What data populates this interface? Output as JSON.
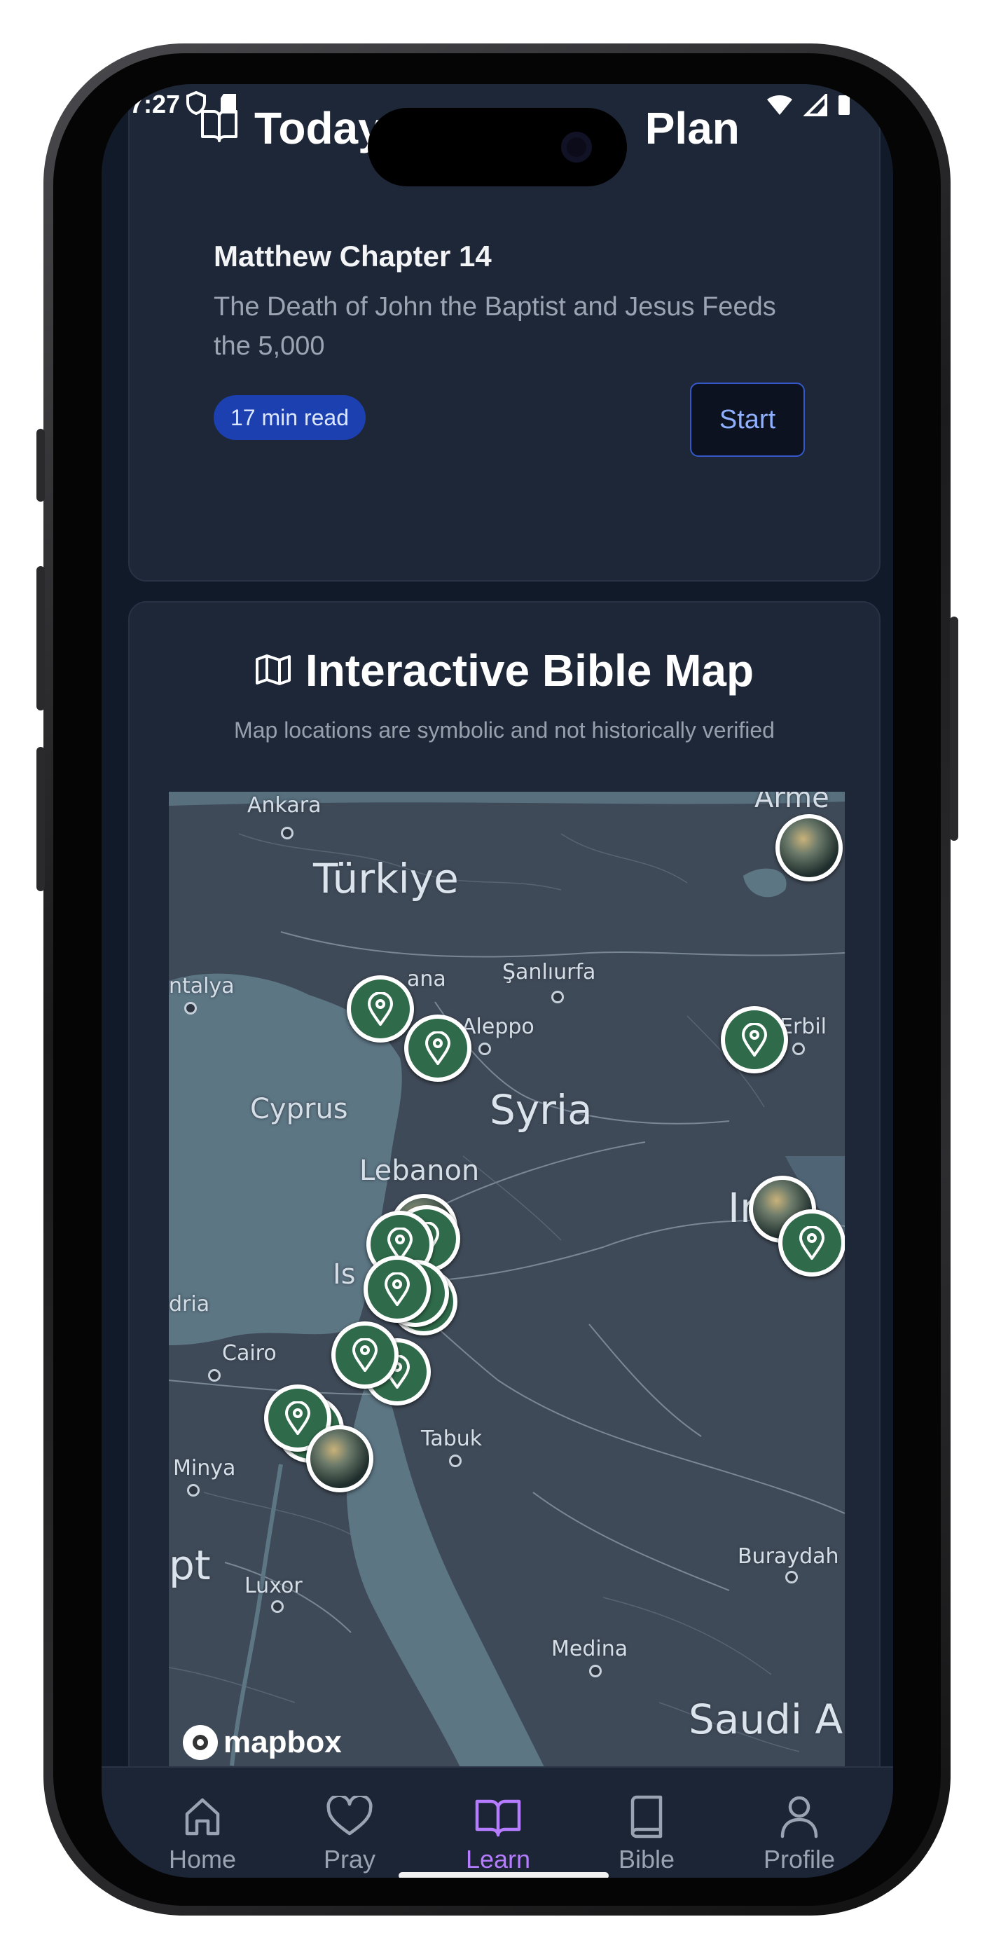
{
  "status_bar": {
    "time": "7:27",
    "left_icons": [
      "shield-icon",
      "sd-card-icon"
    ],
    "right_icons": [
      "wifi-icon",
      "signal-icon",
      "battery-icon"
    ]
  },
  "plan_card": {
    "title_left": "Today",
    "title_right": "Plan",
    "icon": "book-open-icon",
    "reading_title": "Matthew Chapter 14",
    "reading_desc": "The Death of John the Baptist and Jesus Feeds the 5,000",
    "read_time": "17 min read",
    "start_label": "Start"
  },
  "map_card": {
    "icon": "map-icon",
    "title": "Interactive Bible Map",
    "subtitle": "Map locations are symbolic and not historically verified",
    "attribution": "mapbox",
    "labels": {
      "ankara": "Ankara",
      "armenia": "Arme",
      "turkiye": "Türkiye",
      "antalya": "ntalya",
      "adana": "ana",
      "sanliurfa": "Şanlıurfa",
      "aleppo": "Aleppo",
      "erbil": "Erbil",
      "cyprus": "Cyprus",
      "syria": "Syria",
      "lebanon": "Lebanon",
      "iraq": "Ir",
      "israel": "Is",
      "alexandria": "dria",
      "cairo": "Cairo",
      "minya": "Minya",
      "tabuk": "Tabuk",
      "egypt": "pt",
      "luxor": "Luxor",
      "buraydah": "Buraydah",
      "medina": "Medina",
      "saudi": "Saudi A"
    }
  },
  "bottom_nav": {
    "items": [
      {
        "label": "Home",
        "icon": "home-icon"
      },
      {
        "label": "Pray",
        "icon": "heart-icon"
      },
      {
        "label": "Learn",
        "icon": "book-open-icon",
        "active": true
      },
      {
        "label": "Bible",
        "icon": "bible-icon"
      },
      {
        "label": "Profile",
        "icon": "user-icon"
      }
    ]
  },
  "colors": {
    "background": "#111a28",
    "card": "#1e2738",
    "accent": "#b67cff",
    "badge": "#1d40b0",
    "pin": "#2f6b4a"
  }
}
